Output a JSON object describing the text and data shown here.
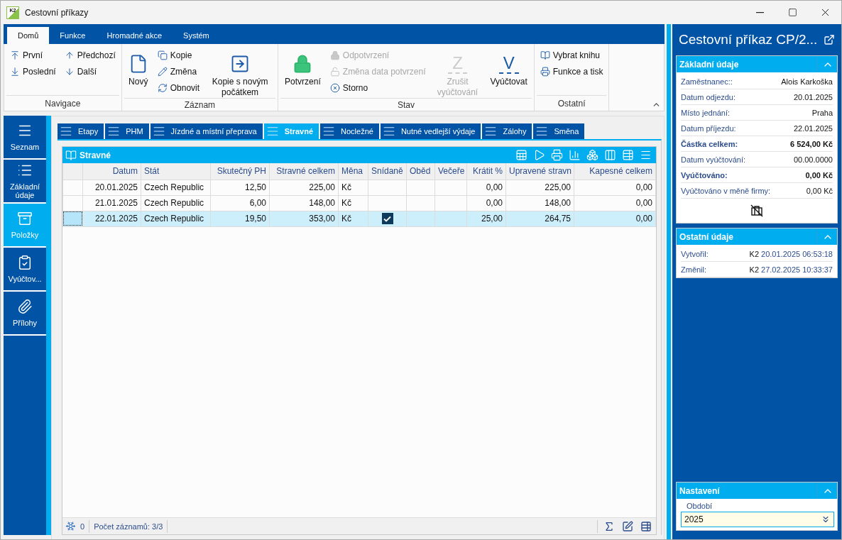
{
  "window": {
    "logo": "K2",
    "title": "Cestovní příkazy"
  },
  "ribbon": {
    "tabs": [
      {
        "label": "Domů",
        "selected": true
      },
      {
        "label": "Funkce",
        "selected": false
      },
      {
        "label": "Hromadné akce",
        "selected": false
      },
      {
        "label": "Systém",
        "selected": false
      }
    ],
    "groups": [
      {
        "label": "Navigace",
        "columns": [
          {
            "kind": "stack",
            "items": [
              {
                "label": "První",
                "disabled": false
              },
              {
                "label": "Poslední",
                "disabled": false
              }
            ]
          },
          {
            "kind": "stack",
            "items": [
              {
                "label": "Předchozí",
                "disabled": false
              },
              {
                "label": "Další",
                "disabled": false
              }
            ]
          }
        ]
      },
      {
        "label": "Záznam",
        "columns": [
          {
            "kind": "large",
            "label": "Nový",
            "disabled": false
          },
          {
            "kind": "stack",
            "items": [
              {
                "label": "Kopie",
                "disabled": false
              },
              {
                "label": "Změna",
                "disabled": false
              },
              {
                "label": "Obnovit",
                "disabled": false
              }
            ]
          },
          {
            "kind": "large",
            "label": "Kopie s novým počátkem",
            "disabled": false
          }
        ]
      },
      {
        "label": "Stav",
        "columns": [
          {
            "kind": "large",
            "label": "Potvrzení",
            "disabled": false
          },
          {
            "kind": "stack",
            "items": [
              {
                "label": "Odpotvrzení",
                "disabled": true
              },
              {
                "label": "Změna data potvrzení",
                "disabled": true
              },
              {
                "label": "Storno",
                "disabled": false
              }
            ]
          },
          {
            "kind": "glyph",
            "glyph": "Z",
            "label": "Zrušit vyúčtování",
            "disabled": true
          },
          {
            "kind": "glyph",
            "glyph": "V",
            "label": "Vyúčtovat",
            "disabled": false
          }
        ]
      },
      {
        "label": "Ostatní",
        "columns": [
          {
            "kind": "stack",
            "items": [
              {
                "label": "Vybrat knihu",
                "disabled": false
              },
              {
                "label": "Funkce a tisk",
                "disabled": false
              }
            ]
          }
        ]
      }
    ]
  },
  "nav": {
    "items": [
      {
        "label": "Seznam",
        "selected": false
      },
      {
        "label": "Základní údaje",
        "selected": false
      },
      {
        "label": "Položky",
        "selected": true
      },
      {
        "label": "Vyúčtov...",
        "selected": false
      },
      {
        "label": "Přílohy",
        "selected": false
      }
    ]
  },
  "doc_tabs": [
    {
      "label": "Etapy",
      "selected": false
    },
    {
      "label": "PHM",
      "selected": false
    },
    {
      "label": "Jízdné a místní přeprava",
      "selected": false
    },
    {
      "label": "Stravné",
      "selected": true
    },
    {
      "label": "Nocležné",
      "selected": false
    },
    {
      "label": "Nutné vedlejší výdaje",
      "selected": false
    },
    {
      "label": "Zálohy",
      "selected": false
    },
    {
      "label": "Směna",
      "selected": false
    }
  ],
  "grid": {
    "title": "Stravné",
    "columns": [
      {
        "label": "Datum",
        "kind": "number"
      },
      {
        "label": "Stát",
        "kind": "text"
      },
      {
        "label": "Skutečný PH",
        "kind": "number"
      },
      {
        "label": "Stravné celkem",
        "kind": "number"
      },
      {
        "label": "Měna",
        "kind": "text"
      },
      {
        "label": "Snídaně",
        "kind": "check"
      },
      {
        "label": "Oběd",
        "kind": "check"
      },
      {
        "label": "Večeře",
        "kind": "check"
      },
      {
        "label": "Krátit %",
        "kind": "number"
      },
      {
        "label": "Upravené stravn",
        "kind": "number"
      },
      {
        "label": "Kapesné celkem",
        "kind": "number"
      }
    ],
    "rows": [
      {
        "selected": false,
        "cells": [
          "20.01.2025",
          "Czech Republic",
          "12,50",
          "225,00",
          "Kč",
          false,
          false,
          false,
          "0,00",
          "225,00",
          "0,00"
        ]
      },
      {
        "selected": false,
        "cells": [
          "21.01.2025",
          "Czech Republic",
          "6,00",
          "148,00",
          "Kč",
          false,
          false,
          false,
          "0,00",
          "148,00",
          "0,00"
        ]
      },
      {
        "selected": true,
        "cells": [
          "22.01.2025",
          "Czech Republic",
          "19,50",
          "353,00",
          "Kč",
          true,
          false,
          false,
          "25,00",
          "264,75",
          "0,00"
        ]
      }
    ],
    "footer": {
      "filter_count": "0",
      "record_count": "Počet záznamů: 3/3"
    }
  },
  "detail": {
    "title": "Cestovní příkaz CP/2...",
    "sections": [
      {
        "title": "Základní údaje",
        "expanded": true,
        "rows": [
          {
            "label": "Zaměstnanec::",
            "value": "Alois Karkoška",
            "bold": false
          },
          {
            "label": "Datum odjezdu:",
            "value": "20.01.2025",
            "bold": false
          },
          {
            "label": "Místo jednání:",
            "value": "Praha",
            "bold": false
          },
          {
            "label": "Datum příjezdu:",
            "value": "22.01.2025",
            "bold": false
          },
          {
            "label": "Částka celkem:",
            "value": "6 524,00 Kč",
            "bold": true
          },
          {
            "label": "Datum vyúčtování:",
            "value": "00.00.0000",
            "bold": false
          },
          {
            "label": "Vyúčtováno:",
            "value": "0,00 Kč",
            "bold": true
          },
          {
            "label": "Vyúčtováno v měně firmy:",
            "value": "0,00 Kč",
            "bold": false
          }
        ]
      },
      {
        "title": "Ostatní údaje",
        "expanded": true,
        "rows": [
          {
            "label": "Vytvořil:",
            "user": "K2",
            "value": "20.01.2025 06:53:18",
            "bold": false
          },
          {
            "label": "Změnil:",
            "user": "K2",
            "value": "27.02.2025 10:33:37",
            "bold": false
          }
        ]
      }
    ],
    "settings": {
      "title": "Nastavení",
      "expanded": true,
      "field_label": "Období",
      "value": "2025"
    }
  }
}
